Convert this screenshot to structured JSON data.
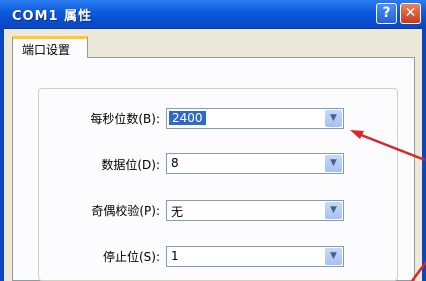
{
  "window": {
    "title": "COM1 属性"
  },
  "titlebar": {
    "help_glyph": "?",
    "close_glyph": "✕"
  },
  "tabs": [
    {
      "label": "端口设置"
    }
  ],
  "settings": [
    {
      "label": "每秒位数(B):",
      "value": "2400",
      "selected": true
    },
    {
      "label": "数据位(D):",
      "value": "8",
      "selected": false
    },
    {
      "label": "奇偶校验(P):",
      "value": "无",
      "selected": false
    },
    {
      "label": "停止位(S):",
      "value": "1",
      "selected": false
    }
  ],
  "icons": {
    "dropdown": "chevron-down-icon"
  },
  "colors": {
    "titlebar_blue": "#0a4fd0",
    "selection_blue": "#316ac5",
    "annotation_red": "#d9262b",
    "tab_highlight": "#ffc83c"
  }
}
